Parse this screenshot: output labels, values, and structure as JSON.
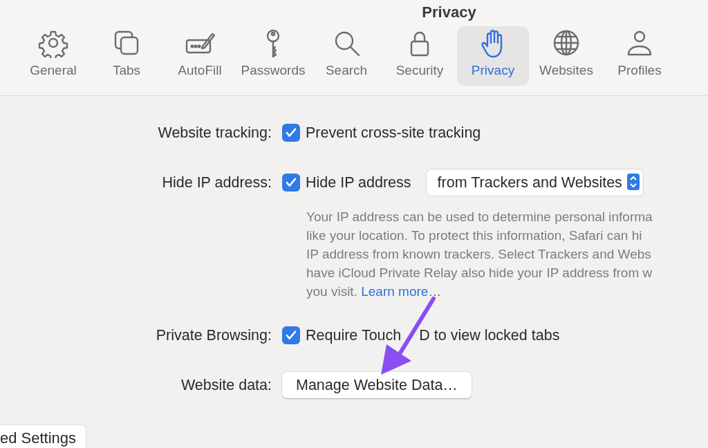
{
  "window": {
    "title": "Privacy"
  },
  "toolbar": [
    {
      "label": "General",
      "selected": false
    },
    {
      "label": "Tabs",
      "selected": false
    },
    {
      "label": "AutoFill",
      "selected": false
    },
    {
      "label": "Passwords",
      "selected": false
    },
    {
      "label": "Search",
      "selected": false
    },
    {
      "label": "Security",
      "selected": false
    },
    {
      "label": "Privacy",
      "selected": true
    },
    {
      "label": "Websites",
      "selected": false
    },
    {
      "label": "Profiles",
      "selected": false
    }
  ],
  "settings": [
    {
      "kind": "checkbox",
      "label": "Website tracking:",
      "option": "Prevent cross-site tracking",
      "checked": true
    },
    {
      "kind": "checkbox",
      "label": "Hide IP address:",
      "option": "Hide IP address",
      "checked": true,
      "popup": "from Trackers and Websites",
      "description_lines": [
        "Your IP address can be used to determine personal informa",
        "like your location. To protect this information, Safari can hi",
        "IP address from known trackers. Select Trackers and Webs",
        "have iCloud Private Relay also hide your IP address from w",
        "you visit."
      ],
      "link": "Learn more…"
    },
    {
      "kind": "checkbox",
      "label": "Private Browsing:",
      "option": "Require Touch",
      "option_after_arrow": "D to view locked tabs",
      "checked": true
    },
    {
      "kind": "button",
      "label": "Website data:",
      "button": "Manage Website Data…"
    }
  ],
  "footer_button": "ed Settings",
  "annotation": {
    "kind": "arrow",
    "color": "#8a4ff0"
  }
}
